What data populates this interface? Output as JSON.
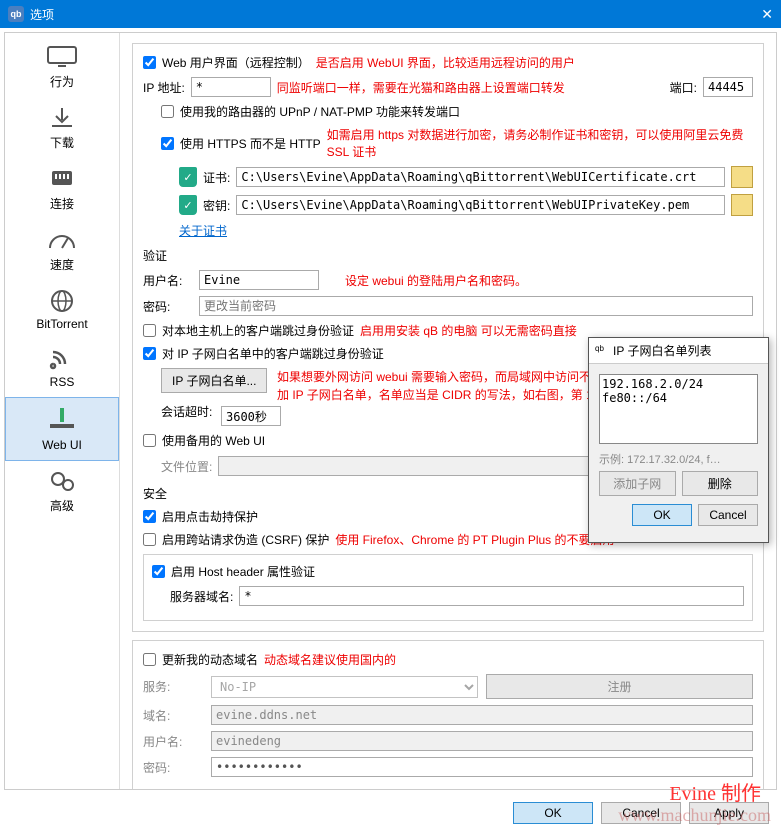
{
  "window": {
    "title": "选项",
    "close": "✕"
  },
  "sidebar": {
    "items": [
      {
        "label": "行为"
      },
      {
        "label": "下载"
      },
      {
        "label": "连接"
      },
      {
        "label": "速度"
      },
      {
        "label": "BitTorrent"
      },
      {
        "label": "RSS"
      },
      {
        "label": "Web UI"
      },
      {
        "label": "高级"
      }
    ]
  },
  "webui": {
    "enable_label": "Web 用户界面（远程控制）",
    "enable_note": "是否启用 WebUI 界面，比较适用远程访问的用户",
    "ip_label": "IP 地址:",
    "ip_value": "*",
    "ip_note": "同监听端口一样，需要在光猫和路由器上设置端口转发",
    "port_label": "端口:",
    "port_value": "44445",
    "upnp_label": "使用我的路由器的 UPnP / NAT-PMP 功能来转发端口",
    "https_label": "使用 HTTPS 而不是 HTTP",
    "https_note": "如需启用 https 对数据进行加密，请务必制作证书和密钥，可以使用阿里云免费 SSL 证书",
    "cert_label": "证书:",
    "cert_value": "C:\\Users\\Evine\\AppData\\Roaming\\qBittorrent\\WebUICertificate.crt",
    "key_label": "密钥:",
    "key_value": "C:\\Users\\Evine\\AppData\\Roaming\\qBittorrent\\WebUIPrivateKey.pem",
    "about_cert": "关于证书",
    "auth_title": "验证",
    "user_label": "用户名:",
    "user_value": "Evine",
    "user_note": "设定 webui 的登陆用户名和密码。",
    "pass_label": "密码:",
    "pass_placeholder": "更改当前密码",
    "bypass_local_label": "对本地主机上的客户端跳过身份验证",
    "bypass_local_note": "启用用安装 qB 的电脑 可以无需密码直接",
    "bypass_subnet_label": "对 IP 子网白名单中的客户端跳过身份验证",
    "subnet_btn": "IP 子网白名单...",
    "subnet_note": "如果想要外网访问 webui 需要输入密码，而局域网中访问不需要输入，则启用此功能并添加 IP 子网白名单，名单应当是 CIDR 的写法，如右图，第 1 行为 ipv4，第 2 行为 ipv6。",
    "timeout_label": "会话超时:",
    "timeout_value": "3600秒",
    "alt_webui_label": "使用备用的 Web UI",
    "file_loc_label": "文件位置:",
    "security_title": "安全",
    "clickjack_label": "启用点击劫持保护",
    "csrf_label": "启用跨站请求伪造 (CSRF) 保护",
    "csrf_note": "使用 Firefox、Chrome 的 PT Plugin Plus 的不要启用",
    "host_header_label": "启用 Host header 属性验证",
    "server_domain_label": "服务器域名:",
    "server_domain_value": "*",
    "dyndns_label": "更新我的动态域名",
    "dyndns_note": "动态域名建议使用国内的",
    "dns_service_label": "服务:",
    "dns_service_value": "No-IP",
    "dns_register": "注册",
    "dns_domain_label": "域名:",
    "dns_domain_value": "evine.ddns.net",
    "dns_user_label": "用户名:",
    "dns_user_value": "evinedeng",
    "dns_pass_label": "密码:"
  },
  "dialog": {
    "title": "IP 子网白名单列表",
    "content": "192.168.2.0/24\nfe80::/64",
    "example": "示例: 172.17.32.0/24, f…",
    "add": "添加子网",
    "delete": "删除",
    "ok": "OK",
    "cancel": "Cancel"
  },
  "footer": {
    "ok": "OK",
    "cancel": "Cancel",
    "apply": "Apply"
  },
  "watermark": {
    "author": "Evine 制作",
    "url": "www.machunjie.com"
  }
}
